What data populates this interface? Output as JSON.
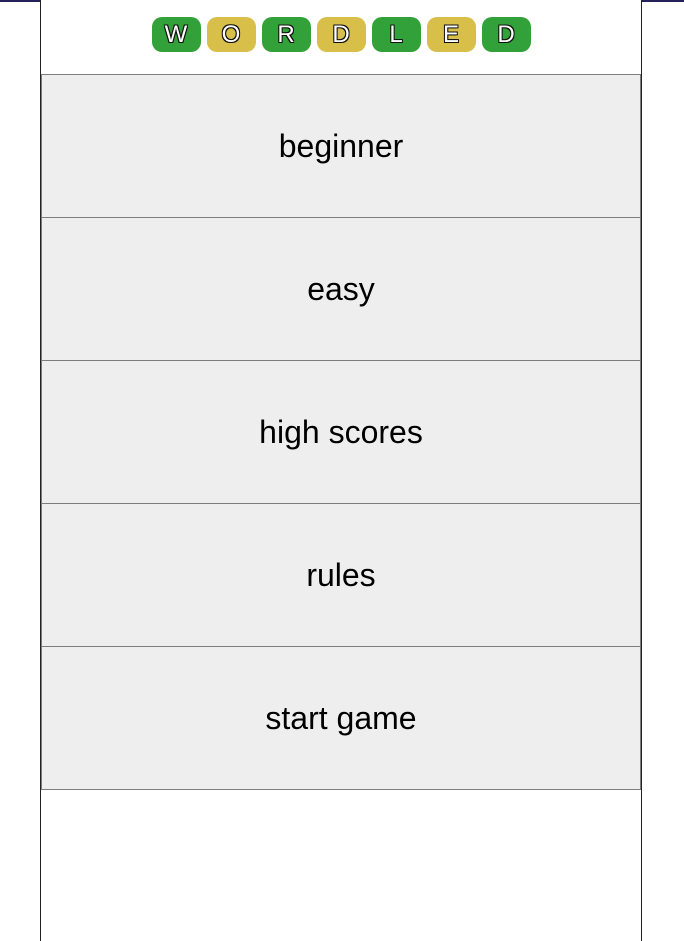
{
  "logo": {
    "tiles": [
      {
        "letter": "W",
        "color": "#33a13a"
      },
      {
        "letter": "O",
        "color": "#d7bf4a"
      },
      {
        "letter": "R",
        "color": "#33a13a"
      },
      {
        "letter": "D",
        "color": "#d7bf4a"
      },
      {
        "letter": "L",
        "color": "#33a13a"
      },
      {
        "letter": "E",
        "color": "#d7bf4a"
      },
      {
        "letter": "D",
        "color": "#33a13a"
      }
    ]
  },
  "menu": {
    "items": [
      {
        "label": "beginner"
      },
      {
        "label": "easy"
      },
      {
        "label": "high scores"
      },
      {
        "label": "rules"
      },
      {
        "label": "start game"
      }
    ]
  }
}
